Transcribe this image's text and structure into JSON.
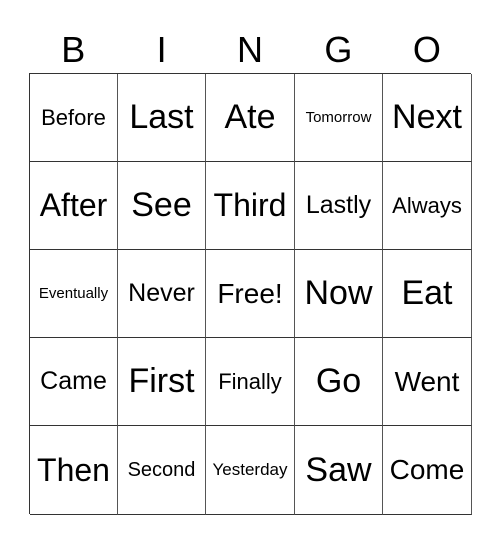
{
  "header": {
    "letters": [
      "B",
      "I",
      "N",
      "G",
      "O"
    ]
  },
  "board": {
    "rows": [
      [
        "Before",
        "Last",
        "Ate",
        "Tomorrow",
        "Next"
      ],
      [
        "After",
        "See",
        "Third",
        "Lastly",
        "Always"
      ],
      [
        "Eventually",
        "Never",
        "Free!",
        "Now",
        "Eat"
      ],
      [
        "Came",
        "First",
        "Finally",
        "Go",
        "Went"
      ],
      [
        "Then",
        "Second",
        "Yesterday",
        "Saw",
        "Come"
      ]
    ]
  }
}
